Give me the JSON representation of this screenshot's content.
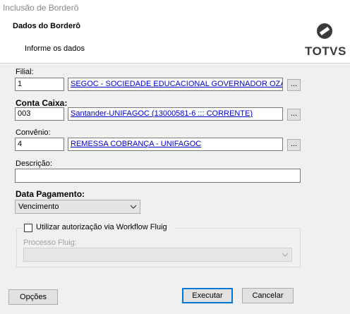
{
  "window": {
    "title": "Inclusão de Borderô"
  },
  "header": {
    "title": "Dados do Borderô",
    "subtitle": "Informe os dados",
    "brand": "TOTVS"
  },
  "form": {
    "filial": {
      "label": "Filial:",
      "code": "1",
      "description": "SEGOC - SOCIEDADE EDUCACIONAL GOVERNADOR OZANAM"
    },
    "conta_caixa": {
      "label": "Conta Caixa:",
      "code": "003",
      "description": "Santander-UNIFAGOC (13000581-6 ::: CORRENTE)"
    },
    "convenio": {
      "label": "Convênio:",
      "code": "4",
      "description": "REMESSA COBRANÇA - UNIFAGOC"
    },
    "descricao": {
      "label": "Descrição:",
      "value": ""
    },
    "data_pagamento": {
      "label": "Data Pagamento:",
      "selected": "Vencimento"
    },
    "workflow": {
      "checkbox_label": "Utilizar autorização via Workflow Fluig",
      "checked": false,
      "processo_label": "Processo Fluig:",
      "processo_value": ""
    },
    "lookup_label": "..."
  },
  "buttons": {
    "options": "Opções",
    "execute": "Executar",
    "cancel": "Cancelar"
  },
  "colors": {
    "link": "#0000cc",
    "focus": "#0078d7",
    "brand": "#3a3a3a"
  }
}
